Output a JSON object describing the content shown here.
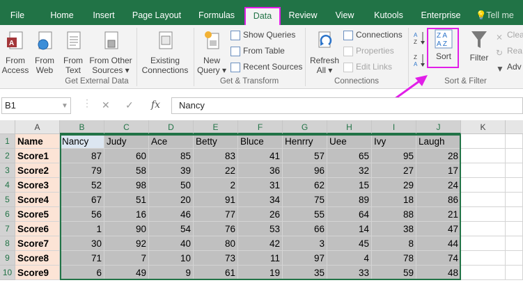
{
  "tabs": [
    {
      "label": "File"
    },
    {
      "label": "Home"
    },
    {
      "label": "Insert"
    },
    {
      "label": "Page Layout"
    },
    {
      "label": "Formulas"
    },
    {
      "label": "Data"
    },
    {
      "label": "Review"
    },
    {
      "label": "View"
    },
    {
      "label": "Kutools"
    },
    {
      "label": "Enterprise"
    },
    {
      "label": "Tell me"
    }
  ],
  "ribbon": {
    "get_external": {
      "from_access": "From Access",
      "from_access_l1": "From",
      "from_access_l2": "Access",
      "from_web_l1": "From",
      "from_web_l2": "Web",
      "from_text_l1": "From",
      "from_text_l2": "Text",
      "from_other_l1": "From Other",
      "from_other_l2": "Sources ▾",
      "existing_l1": "Existing",
      "existing_l2": "Connections",
      "group": "Get External Data"
    },
    "get_transform": {
      "new_query_l1": "New",
      "new_query_l2": "Query ▾",
      "show_queries": "Show Queries",
      "from_table": "From Table",
      "recent_sources": "Recent Sources",
      "group": "Get & Transform"
    },
    "connections": {
      "refresh_l1": "Refresh",
      "refresh_l2": "All ▾",
      "connections": "Connections",
      "properties": "Properties",
      "edit_links": "Edit Links",
      "group": "Connections"
    },
    "sort_filter": {
      "sort": "Sort",
      "filter": "Filter",
      "clear": "Clea",
      "reapply": "Rea",
      "advanced": "Adv",
      "group": "Sort & Filter"
    }
  },
  "formula_bar": {
    "name_box": "B1",
    "fx": "fx",
    "value": "Nancy"
  },
  "columns": [
    "A",
    "B",
    "C",
    "D",
    "E",
    "F",
    "G",
    "H",
    "I",
    "J",
    "K"
  ],
  "rows": [
    "1",
    "2",
    "3",
    "4",
    "5",
    "6",
    "7",
    "8",
    "9",
    "10"
  ],
  "header_row": [
    "Name",
    "Nancy",
    "Judy",
    "Ace",
    "Betty",
    "Bluce",
    "Henrry",
    "Uee",
    "Ivy",
    "Laugh"
  ],
  "data_rows": [
    {
      "label": "Score1",
      "values": [
        "87",
        "60",
        "85",
        "83",
        "41",
        "57",
        "65",
        "95",
        "28"
      ]
    },
    {
      "label": "Score2",
      "values": [
        "79",
        "58",
        "39",
        "22",
        "36",
        "96",
        "32",
        "27",
        "17"
      ]
    },
    {
      "label": "Score3",
      "values": [
        "52",
        "98",
        "50",
        "2",
        "31",
        "62",
        "15",
        "29",
        "24"
      ]
    },
    {
      "label": "Score4",
      "values": [
        "67",
        "51",
        "20",
        "91",
        "34",
        "75",
        "89",
        "18",
        "86"
      ]
    },
    {
      "label": "Score5",
      "values": [
        "56",
        "16",
        "46",
        "77",
        "26",
        "55",
        "64",
        "88",
        "21"
      ]
    },
    {
      "label": "Score6",
      "values": [
        "1",
        "90",
        "54",
        "76",
        "53",
        "66",
        "14",
        "38",
        "47"
      ]
    },
    {
      "label": "Score7",
      "values": [
        "30",
        "92",
        "40",
        "80",
        "42",
        "3",
        "45",
        "8",
        "44"
      ]
    },
    {
      "label": "Score8",
      "values": [
        "71",
        "7",
        "10",
        "73",
        "11",
        "97",
        "4",
        "78",
        "74"
      ]
    },
    {
      "label": "Score9",
      "values": [
        "6",
        "49",
        "9",
        "61",
        "19",
        "35",
        "33",
        "59",
        "48"
      ]
    }
  ],
  "colors": {
    "ribbon_green": "#217346",
    "highlight_magenta": "#e11ee8",
    "name_col_bg": "#fce4d6",
    "data_bg": "#c0c0c0"
  }
}
